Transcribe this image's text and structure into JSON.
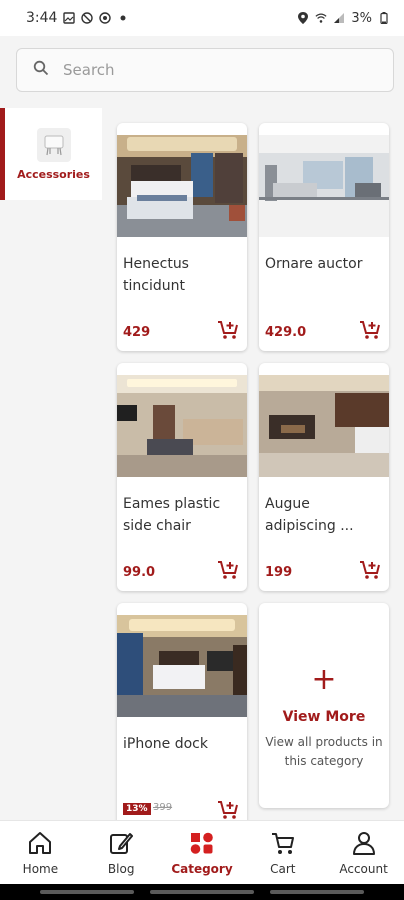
{
  "status_bar": {
    "time": "3:44",
    "battery": "3%"
  },
  "search": {
    "placeholder": "Search"
  },
  "sidebar": {
    "items": [
      {
        "label": "Accessories",
        "active": true
      }
    ]
  },
  "products": [
    {
      "name": "Henectus tincidunt",
      "price": "429"
    },
    {
      "name": "Ornare auctor",
      "price": "429.0"
    },
    {
      "name": "Eames plastic side chair",
      "price": "99.0"
    },
    {
      "name": "Augue adipiscing ...",
      "price": "199"
    },
    {
      "name": "iPhone dock",
      "discount": "13%",
      "old_price": "399"
    }
  ],
  "view_more": {
    "symbol": "+",
    "title": "View More",
    "subtitle": "View all products in this category"
  },
  "bottom_nav": {
    "items": [
      {
        "label": "Home",
        "icon": "home-icon"
      },
      {
        "label": "Blog",
        "icon": "blog-edit-icon"
      },
      {
        "label": "Category",
        "icon": "category-grid-icon",
        "active": true
      },
      {
        "label": "Cart",
        "icon": "cart-icon"
      },
      {
        "label": "Account",
        "icon": "account-icon"
      }
    ]
  },
  "colors": {
    "accent": "#a11b1b",
    "background": "#f4f4f4",
    "card": "#ffffff"
  }
}
